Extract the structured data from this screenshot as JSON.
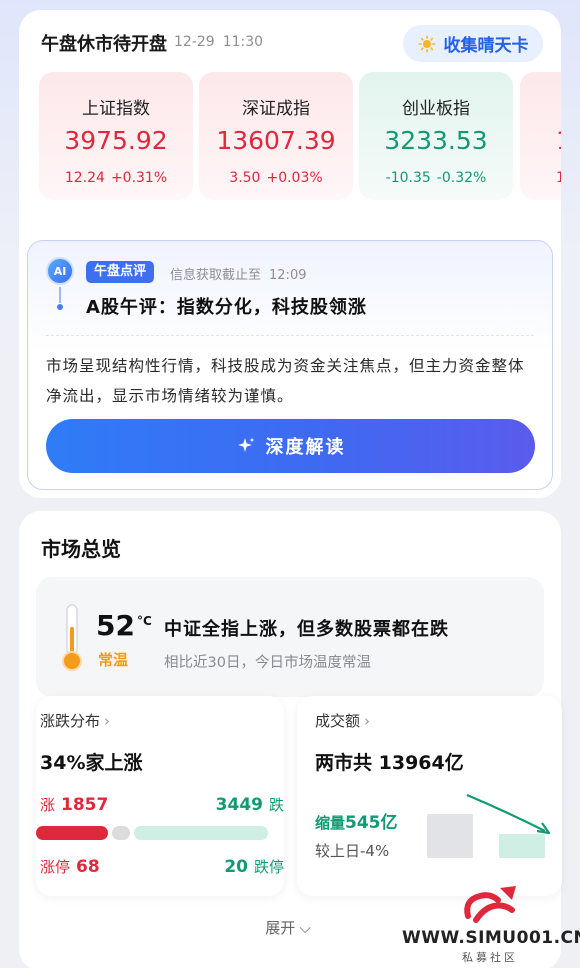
{
  "header": {
    "title": "午盘休市待开盘",
    "date": "12-29",
    "time": "11:30",
    "collect_button": "收集晴天卡"
  },
  "indices": [
    {
      "name": "上证指数",
      "value": "3975.92",
      "change": "12.24",
      "percent": "+0.31%",
      "trend": "up"
    },
    {
      "name": "深证成指",
      "value": "13607.39",
      "change": "3.50",
      "percent": "+0.03%",
      "trend": "up"
    },
    {
      "name": "创业板指",
      "value": "3233.53",
      "change": "-10.35",
      "percent": "-0.32%",
      "trend": "down"
    },
    {
      "name": "",
      "value": "1",
      "change": "1",
      "percent": "",
      "trend": "up"
    }
  ],
  "commentary": {
    "badge": "AI",
    "tag": "午盘点评",
    "note": "信息获取截止至",
    "note_time": "12:09",
    "title": "A股午评：指数分化，科技股领涨",
    "body": "市场呈现结构性行情，科技股成为资金关注焦点，但主力资金整体净流出，显示市场情绪较为谨慎。",
    "button": "深度解读"
  },
  "market": {
    "title": "市场总览",
    "temperature": {
      "value": "52",
      "unit": "°C",
      "level": "常温",
      "headline": "中证全指上涨，但多数股票都在跌",
      "sub": "相比近30日，今日市场温度常温"
    },
    "breadth": {
      "title": "涨跌分布",
      "headline_num": "34%",
      "headline_txt": "家上涨",
      "rise_label": "涨",
      "rise_count": "1857",
      "fall_count": "3449",
      "fall_label": "跌",
      "limit_up_label": "涨停",
      "limit_up": "68",
      "limit_down": "20",
      "limit_down_label": "跌停",
      "rise_fraction": 0.34
    },
    "volume": {
      "title": "成交额",
      "headline_pre": "两市共",
      "headline_num": "13964亿",
      "shrink_label": "缩量",
      "shrink_value": "545亿",
      "compare_label": "较上日",
      "compare_value": "-4%"
    },
    "expand": "展开"
  },
  "watermark": {
    "site": "WWW.SIMU001.CN",
    "sub": "私募社区"
  },
  "colors": {
    "up": "#e0283d",
    "down": "#129a73",
    "accent": "#3d6ff0",
    "warm": "#f39b1d"
  },
  "icons": {
    "collect": "sun-icon",
    "deep": "sparkle-icon",
    "temperature": "thermometer-icon",
    "more": "chevron-right-icon",
    "expand": "chevron-down-icon"
  }
}
